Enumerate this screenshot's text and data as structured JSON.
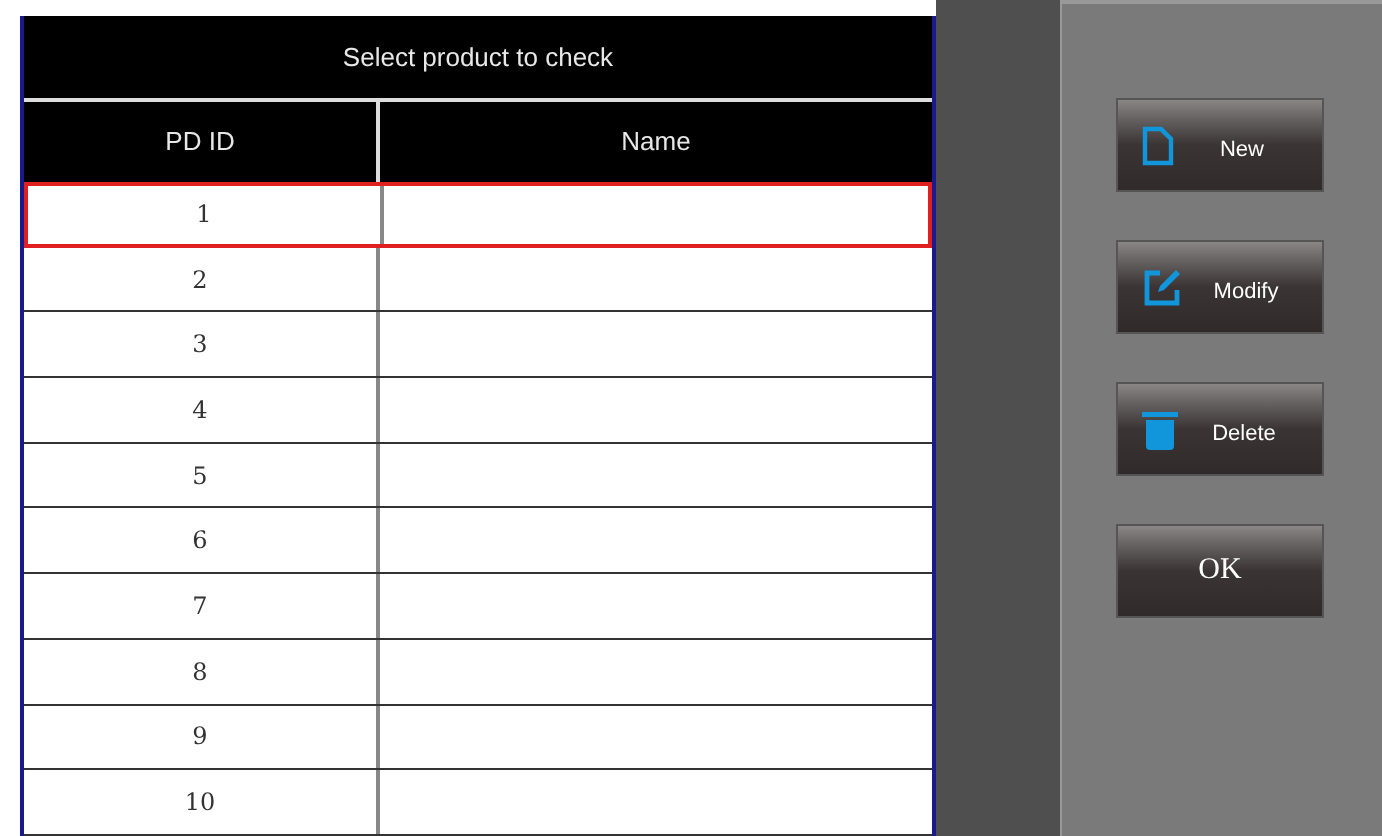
{
  "title": "Select product to check",
  "columns": [
    "PD ID",
    "Name"
  ],
  "rows": [
    {
      "id": "1",
      "selected": true
    },
    {
      "id": "2",
      "selected": false
    },
    {
      "id": "3",
      "selected": false
    },
    {
      "id": "4",
      "selected": false
    },
    {
      "id": "5",
      "selected": false
    },
    {
      "id": "6",
      "selected": false
    },
    {
      "id": "7",
      "selected": false
    },
    {
      "id": "8",
      "selected": false
    },
    {
      "id": "9",
      "selected": false
    },
    {
      "id": "10",
      "selected": false
    }
  ],
  "buttons": [
    {
      "kind": "new",
      "label": "New"
    },
    {
      "kind": "modify",
      "label": "Modify"
    },
    {
      "kind": "delete",
      "label": "Delete"
    },
    {
      "kind": "ok",
      "label": "OK"
    }
  ]
}
